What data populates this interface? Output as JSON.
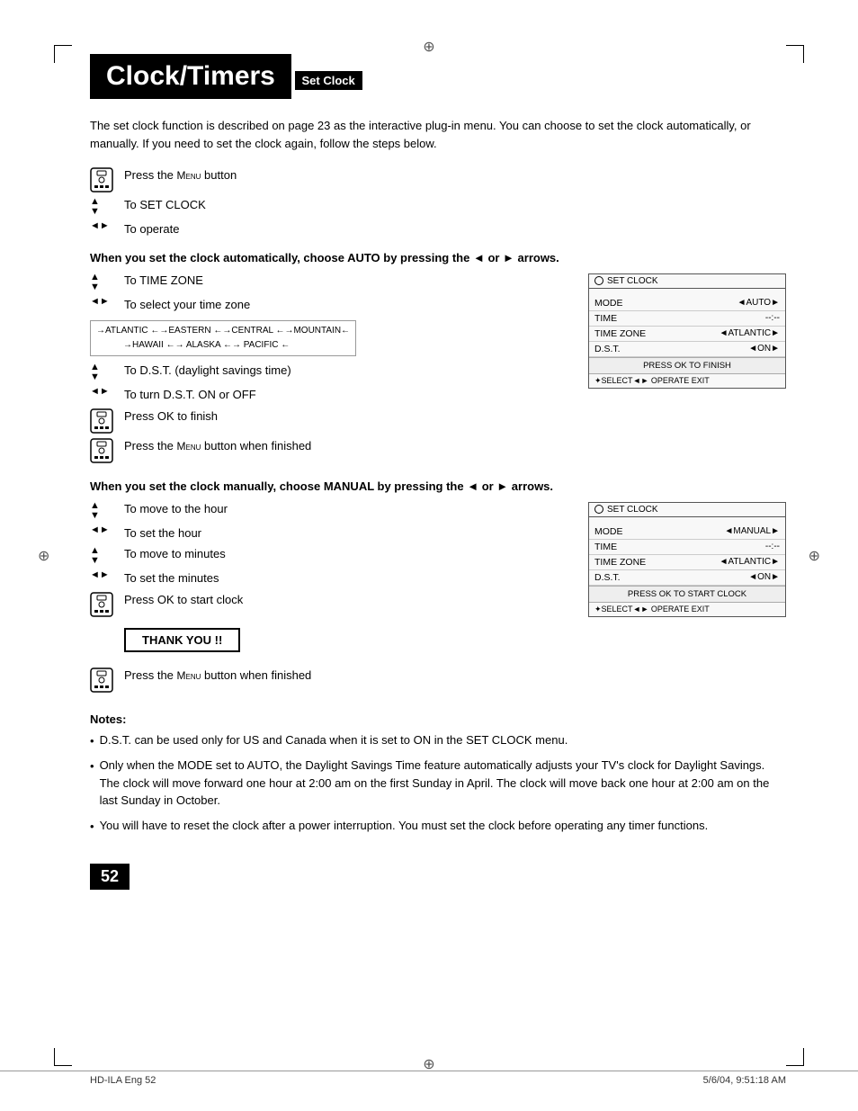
{
  "page": {
    "title": "Clock/Timers",
    "page_number": "52",
    "footer_left": "HD-ILA Eng  52",
    "footer_right": "5/6/04, 9:51:18 AM"
  },
  "section": {
    "heading": "Set Clock",
    "intro": "The set clock function is described on page 23 as the interactive plug-in menu. You can choose to set the clock automatically, or manually. If you need to set the clock again, follow the steps below."
  },
  "initial_steps": [
    {
      "icon": "remote",
      "text": "Press the MENU button"
    },
    {
      "icon": "arrow-ud",
      "text": "To SET CLOCK"
    },
    {
      "icon": "arrow-lr",
      "text": "To operate"
    }
  ],
  "auto_section": {
    "bold_line": "When you set the clock automatically, choose AUTO by pressing the ◄ or ► arrows.",
    "steps": [
      {
        "icon": "arrow-ud",
        "text": "To TIME ZONE"
      },
      {
        "icon": "arrow-lr",
        "text": "To select your time zone"
      },
      {
        "icon": "arrow-ud",
        "text": "To D.S.T. (daylight savings time)"
      },
      {
        "icon": "arrow-lr",
        "text": "To turn D.S.T. ON or OFF"
      },
      {
        "icon": "remote",
        "text": "Press OK to finish"
      },
      {
        "icon": "remote",
        "text": "Press the MENU button when finished"
      }
    ],
    "timezone_row1": "→ATLANTIC ←→EASTERN ←→CENTRAL ←→MOUNTAIN←",
    "timezone_row2": "→HAWAII ←→ ALASKA ←→ PACIFIC ←",
    "screen": {
      "title": "SET CLOCK",
      "rows": [
        {
          "label": "MODE",
          "value": "◄AUTO►"
        },
        {
          "label": "TIME",
          "value": "-- : --"
        },
        {
          "label": "TIME ZONE",
          "value": "◄ATLANTIC►"
        },
        {
          "label": "D.S.T.",
          "value": "◄ON►"
        }
      ],
      "footer": "PRESS OK TO FINISH",
      "nav": "✦SELECT◄► OPERATE      EXIT"
    }
  },
  "manual_section": {
    "bold_line": "When you set the clock manually, choose MANUAL by pressing the ◄ or ► arrows.",
    "steps": [
      {
        "icon": "arrow-ud",
        "text": "To move to the hour"
      },
      {
        "icon": "arrow-lr",
        "text": "To set the hour"
      },
      {
        "icon": "arrow-ud",
        "text": "To move to minutes"
      },
      {
        "icon": "arrow-lr",
        "text": "To set the minutes"
      },
      {
        "icon": "remote",
        "text": "Press OK to start clock"
      }
    ],
    "thank_you": "THANK YOU !!",
    "final_step": {
      "icon": "remote",
      "text": "Press the MENU button when finished"
    },
    "screen": {
      "title": "SET CLOCK",
      "rows": [
        {
          "label": "MODE",
          "value": "◄MANUAL►"
        },
        {
          "label": "TIME",
          "value": "-- : --"
        },
        {
          "label": "TIME ZONE",
          "value": "◄ATLANTIC►"
        },
        {
          "label": "D.S.T.",
          "value": "◄ON►"
        }
      ],
      "footer": "PRESS OK TO START CLOCK",
      "nav": "✦SELECT◄► OPERATE      EXIT"
    }
  },
  "notes": {
    "title": "Notes:",
    "items": [
      "D.S.T. can be used only for US and Canada when it is set to ON in the SET CLOCK menu.",
      "Only when the MODE set to AUTO, the Daylight Savings Time feature automatically adjusts your TV's clock for Daylight Savings. The clock will move forward one hour at 2:00 am on the first Sunday in April. The clock will move back one hour at 2:00 am on the last Sunday in October.",
      "You will have to reset the clock after a power interruption. You must set the clock before operating any timer functions."
    ]
  }
}
